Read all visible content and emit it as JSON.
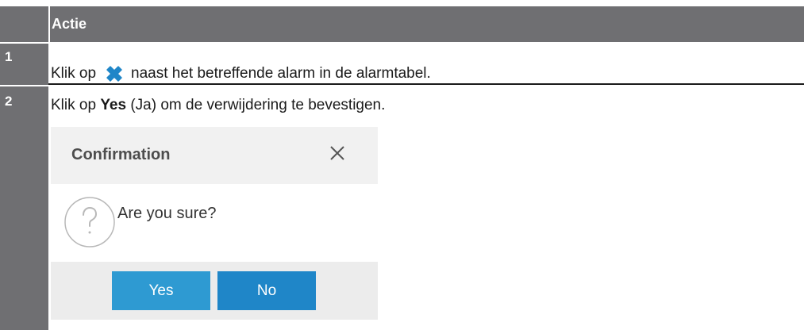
{
  "table": {
    "header": {
      "action_label": "Actie"
    },
    "steps": [
      {
        "number": "1",
        "text_before": "Klik op",
        "icon": "x-icon",
        "text_after": "naast het betreffende alarm in de alarmtabel."
      },
      {
        "number": "2",
        "text_before": "Klik op",
        "bold": "Yes",
        "text_after": "(Ja) om de verwijdering te bevestigen."
      }
    ]
  },
  "dialog": {
    "title": "Confirmation",
    "close_icon": "close-icon",
    "message_icon": "question-icon",
    "message": "Are you sure?",
    "buttons": {
      "yes": "Yes",
      "no": "No"
    }
  },
  "colors": {
    "header_bg": "#6f6f72",
    "x_icon": "#1f86c8",
    "yes_button": "#2e9ad2",
    "no_button": "#1f86c8",
    "dialog_header_bg": "#f1f1f1",
    "dialog_footer_bg": "#ececec"
  }
}
